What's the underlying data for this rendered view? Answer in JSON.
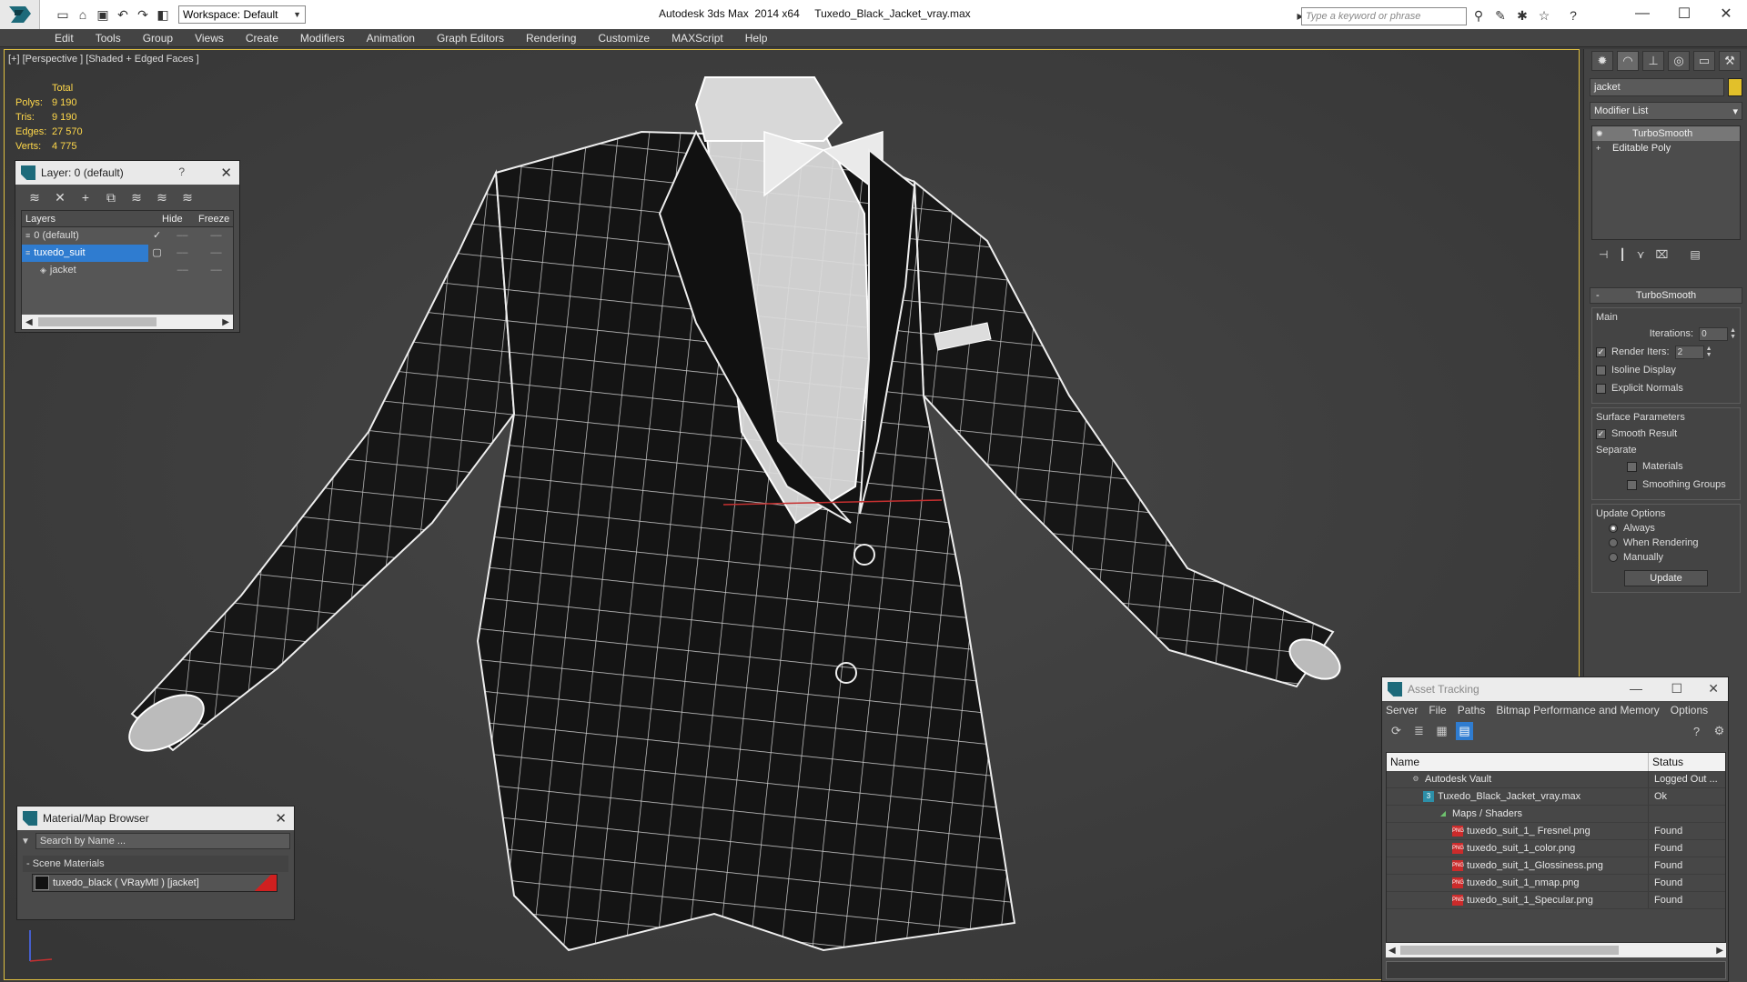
{
  "window": {
    "app_title": "Autodesk 3ds Max  2014 x64",
    "file_name": "Tuxedo_Black_Jacket_vray.max",
    "workspace": "Workspace: Default",
    "search_placeholder": "Type a keyword or phrase"
  },
  "menu": [
    "Edit",
    "Tools",
    "Group",
    "Views",
    "Create",
    "Modifiers",
    "Animation",
    "Graph Editors",
    "Rendering",
    "Customize",
    "MAXScript",
    "Help"
  ],
  "viewport": {
    "label": "[+] [Perspective ] [Shaded + Edged Faces ]",
    "stats": {
      "header": "Total",
      "rows": [
        {
          "k": "Polys:",
          "v": "9 190"
        },
        {
          "k": "Tris:",
          "v": "9 190"
        },
        {
          "k": "Edges:",
          "v": "27 570"
        },
        {
          "k": "Verts:",
          "v": "4 775"
        }
      ]
    }
  },
  "layer_panel": {
    "title": "Layer: 0 (default)",
    "help": "?",
    "columns": {
      "layers": "Layers",
      "hide": "Hide",
      "freeze": "Freeze"
    },
    "rows": [
      {
        "name": "0 (default)",
        "selected": false,
        "active": true
      },
      {
        "name": "tuxedo_suit",
        "selected": true,
        "active": false
      },
      {
        "name": "jacket",
        "selected": false,
        "active": false
      }
    ]
  },
  "material_browser": {
    "title": "Material/Map Browser",
    "search_placeholder": "Search by Name ...",
    "section": "- Scene Materials",
    "item": "tuxedo_black  ( VRayMtl ) [jacket]"
  },
  "command_panel": {
    "object_name": "jacket",
    "object_color": "#e2c02a",
    "modifier_list": "Modifier List",
    "stack": [
      "TurboSmooth",
      "Editable Poly"
    ],
    "rollout_title": "TurboSmooth",
    "main_group": "Main",
    "iterations_label": "Iterations:",
    "iterations": "0",
    "render_iters_label": "Render Iters:",
    "render_iters": "2",
    "isoline": "Isoline Display",
    "explicit_normals": "Explicit Normals",
    "surface_group": "Surface Parameters",
    "smooth_result": "Smooth Result",
    "separate": "Separate",
    "materials": "Materials",
    "smoothing_groups": "Smoothing Groups",
    "update_group": "Update Options",
    "always": "Always",
    "when_rendering": "When Rendering",
    "manually": "Manually",
    "update_button": "Update"
  },
  "asset_tracking": {
    "title": "Asset Tracking",
    "menu": [
      "Server",
      "File",
      "Paths",
      "Bitmap Performance and Memory",
      "Options"
    ],
    "columns": {
      "name": "Name",
      "status": "Status"
    },
    "rows": [
      {
        "name": "Autodesk Vault",
        "status": "Logged Out ...",
        "icon": "vault",
        "indent": 1
      },
      {
        "name": "Tuxedo_Black_Jacket_vray.max",
        "status": "Ok",
        "icon": "max",
        "indent": 2
      },
      {
        "name": "Maps / Shaders",
        "status": "",
        "icon": "map",
        "indent": 3
      },
      {
        "name": "tuxedo_suit_1_ Fresnel.png",
        "status": "Found",
        "icon": "png",
        "indent": 4
      },
      {
        "name": "tuxedo_suit_1_color.png",
        "status": "Found",
        "icon": "png",
        "indent": 4
      },
      {
        "name": "tuxedo_suit_1_Glossiness.png",
        "status": "Found",
        "icon": "png",
        "indent": 4
      },
      {
        "name": "tuxedo_suit_1_nmap.png",
        "status": "Found",
        "icon": "png",
        "indent": 4
      },
      {
        "name": "tuxedo_suit_1_Specular.png",
        "status": "Found",
        "icon": "png",
        "indent": 4
      }
    ]
  }
}
